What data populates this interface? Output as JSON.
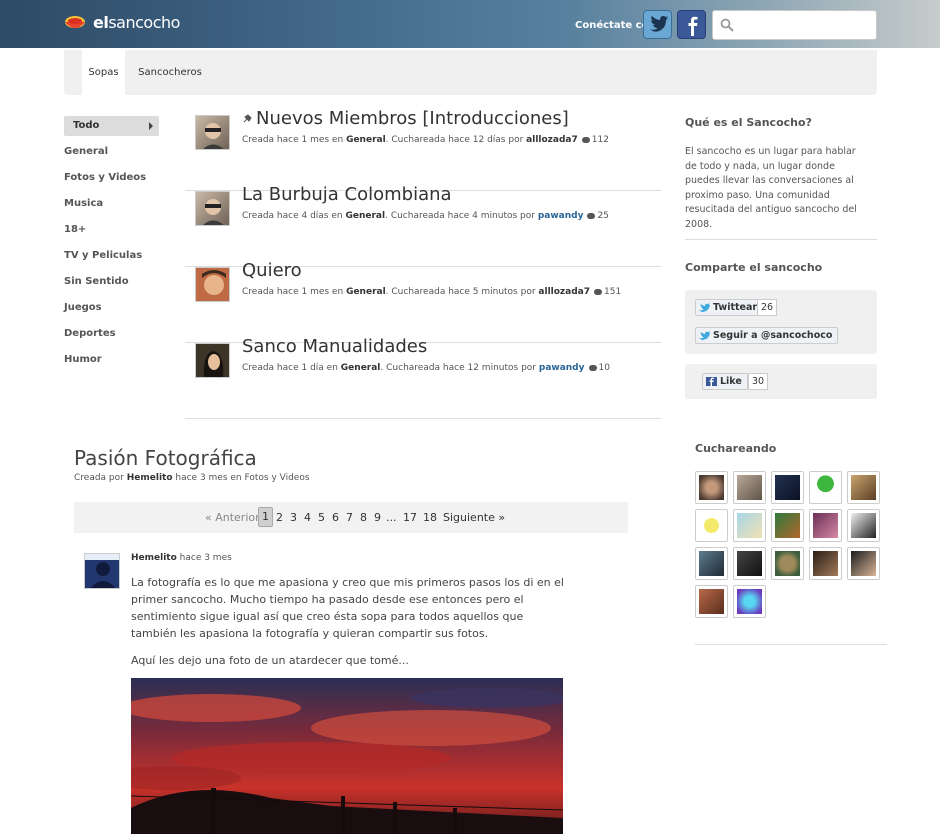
{
  "header": {
    "logo_bold": "el",
    "logo_rest": "sancocho",
    "connect_label": "Conéctate con",
    "search_placeholder": ""
  },
  "nav": {
    "tabs": [
      {
        "label": "Sopas"
      },
      {
        "label": "Sancocheros"
      }
    ]
  },
  "categories": [
    {
      "label": "Todo"
    },
    {
      "label": "General"
    },
    {
      "label": "Fotos y Videos"
    },
    {
      "label": "Musica"
    },
    {
      "label": "18+"
    },
    {
      "label": "TV y Peliculas"
    },
    {
      "label": "Sin Sentido"
    },
    {
      "label": "Juegos"
    },
    {
      "label": "Deportes"
    },
    {
      "label": "Humor"
    }
  ],
  "topics": [
    {
      "title": "Nuevos Miembros [Introducciones]",
      "created": "Creada hace 1 mes en",
      "category": "General",
      "updated": ". Cuchareada hace 12 días por",
      "user": "alllozada7",
      "comments": "112"
    },
    {
      "title": "La Burbuja Colombiana",
      "created": "Creada hace 4 días en",
      "category": "General",
      "updated": ". Cuchareada hace 4 minutos por",
      "user": "pawandy",
      "comments": "25"
    },
    {
      "title": "Quiero",
      "created": "Creada hace 1 mes en",
      "category": "General",
      "updated": ". Cuchareada hace 5 minutos por",
      "user": "alllozada7",
      "comments": "151"
    },
    {
      "title": "Sanco Manualidades",
      "created": "Creada hace 1 día en",
      "category": "General",
      "updated": ". Cuchareada hace 12 minutos por",
      "user": "pawandy",
      "comments": "10"
    }
  ],
  "about": {
    "heading": "Qué es el Sancocho?",
    "text": "El sancocho es un lugar para hablar de todo y nada, un lugar donde puedes llevar las conversaciones al proximo paso. Una comunidad resucitada del antiguo sancocho del 2008."
  },
  "share": {
    "heading": "Comparte el sancocho",
    "tweet_label": "Twittear",
    "tweet_count": "26",
    "follow_label": "Seguir a @sancochoco",
    "like_label": "Like",
    "like_count": "30"
  },
  "active_users": {
    "heading": "Cuchareando"
  },
  "post": {
    "title": "Pasión Fotográfica",
    "created_prefix": "Creada por",
    "author": "Hemelito",
    "created_suffix": "hace 3 mes en Fotos y Videos",
    "time": "hace 3 mes",
    "paragraph1": "La fotografía es lo que me apasiona y creo que mis primeros pasos los di en el primer sancocho. Mucho tiempo ha pasado desde ese entonces pero el sentimiento sigue igual así que creo ésta sopa para todos aquellos que también les apasiona la fotografía y quieran compartir sus fotos.",
    "paragraph2": "Aquí les dejo una foto de un atardecer que tomé..."
  },
  "pager": {
    "prev": "« Anterior",
    "pages": [
      "1",
      "2",
      "3",
      "4",
      "5",
      "6",
      "7",
      "8",
      "9",
      "...",
      "17",
      "18"
    ],
    "next": "Siguiente »"
  }
}
